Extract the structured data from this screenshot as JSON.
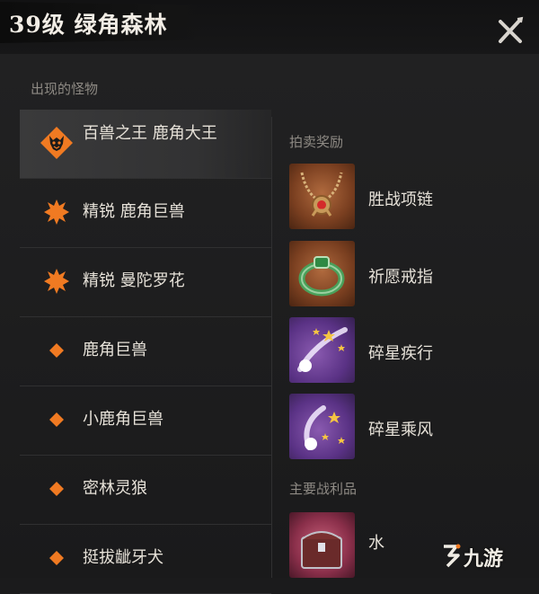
{
  "header": {
    "title": "39级 绿角森林",
    "close_icon": "close-icon"
  },
  "monsters": {
    "label": "出现的怪物",
    "items": [
      {
        "name": "百兽之王 鹿角大王",
        "icon": "boss-demon-icon"
      },
      {
        "name": "精锐 鹿角巨兽",
        "icon": "elite-spike-icon"
      },
      {
        "name": "精锐 曼陀罗花",
        "icon": "elite-spike-icon"
      },
      {
        "name": "鹿角巨兽",
        "icon": "diamond-icon"
      },
      {
        "name": "小鹿角巨兽",
        "icon": "diamond-icon"
      },
      {
        "name": "密林灵狼",
        "icon": "diamond-icon"
      },
      {
        "name": "挺拔龇牙犬",
        "icon": "diamond-icon"
      }
    ]
  },
  "auction": {
    "label": "拍卖奖励",
    "items": [
      {
        "name": "胜战项链",
        "icon": "necklace-icon"
      },
      {
        "name": "祈愿戒指",
        "icon": "ring-icon"
      },
      {
        "name": "碎星疾行",
        "icon": "comet-icon"
      },
      {
        "name": "碎星乘风",
        "icon": "comet-icon"
      }
    ]
  },
  "loot": {
    "label": "主要战利品",
    "items": [
      {
        "name": "水",
        "icon": "chest-icon"
      }
    ]
  },
  "watermark": {
    "text": "九游"
  },
  "colors": {
    "accent": "#f07a22",
    "background": "#1d1d1e",
    "text": "#e6e1d8",
    "muted": "#8e8a84"
  }
}
